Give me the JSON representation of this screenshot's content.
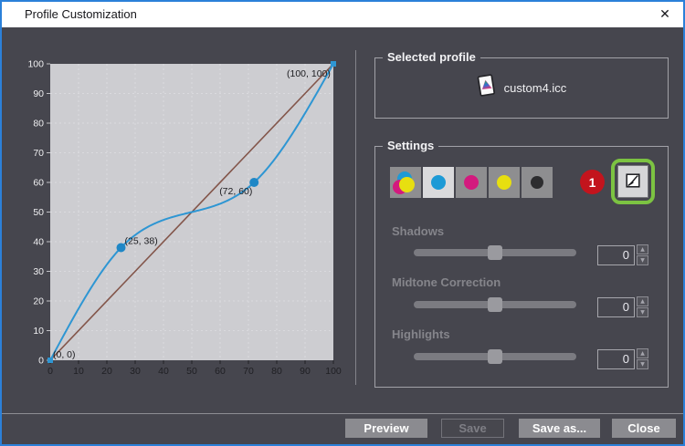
{
  "window": {
    "title": "Profile Customization",
    "close_glyph": "✕"
  },
  "chart_data": {
    "type": "line",
    "title": "",
    "xlabel": "",
    "ylabel": "",
    "xlim": [
      0,
      100
    ],
    "ylim": [
      0,
      100
    ],
    "x_ticks": [
      0,
      10,
      20,
      30,
      40,
      50,
      60,
      70,
      80,
      90,
      100
    ],
    "y_ticks": [
      0,
      10,
      20,
      30,
      40,
      50,
      60,
      70,
      80,
      90,
      100
    ],
    "grid": true,
    "legend": false,
    "series": [
      {
        "name": "reference-diagonal",
        "curve": "straight",
        "points": [
          [
            0,
            0
          ],
          [
            100,
            100
          ]
        ],
        "color": "#83564b",
        "width": 1.6
      },
      {
        "name": "tone-curve",
        "curve": "spline",
        "points": [
          [
            0,
            0
          ],
          [
            25,
            38
          ],
          [
            72,
            60
          ],
          [
            100,
            100
          ]
        ],
        "color": "#2e96d3",
        "width": 2
      }
    ],
    "point_labels": [
      {
        "text": "(0, 0)",
        "x": 0,
        "y": 0,
        "dx": 3,
        "dy": -3,
        "marker": "square"
      },
      {
        "text": "(25, 38)",
        "x": 25,
        "y": 38,
        "dx": 4,
        "dy": -4,
        "marker": "circle"
      },
      {
        "text": "(72, 60)",
        "x": 72,
        "y": 60,
        "dx": -38,
        "dy": 13,
        "marker": "circle"
      },
      {
        "text": "(100, 100)",
        "x": 100,
        "y": 100,
        "dx": -51,
        "dy": 14,
        "marker": "square"
      }
    ],
    "colors": {
      "plot_bg": "#cdcdd1",
      "grid": "#dadade",
      "y_tick": "#c2c2c7",
      "x_tick": "#222226",
      "y_label": "#f0f0f2",
      "x_label": "#1f1f23",
      "point_label": "#1c1c20",
      "marker_circle": "#1f87c6",
      "marker_square": "#2e96d3"
    }
  },
  "selected_profile": {
    "group_label": "Selected profile",
    "file_name": "custom4.icc"
  },
  "settings": {
    "group_label": "Settings",
    "channels": [
      {
        "name": "all-cmy",
        "selected": false
      },
      {
        "name": "cyan",
        "selected": true
      },
      {
        "name": "magenta",
        "selected": false
      },
      {
        "name": "yellow",
        "selected": false
      },
      {
        "name": "black",
        "selected": false
      }
    ],
    "channel_colors": {
      "cyan": "#1d9ad6",
      "magenta": "#d31a7e",
      "yellow": "#e7df10",
      "black": "#2d2d2f"
    },
    "annotation_badge": "1",
    "badge_color": "#c3141d",
    "highlight_color": "#7cc342",
    "spin_up_glyph": "▲",
    "spin_down_glyph": "▼",
    "sliders": [
      {
        "label": "Shadows",
        "value": "0"
      },
      {
        "label": "Midtone Correction",
        "value": "0"
      },
      {
        "label": "Highlights",
        "value": "0"
      }
    ]
  },
  "footer": {
    "buttons": [
      {
        "label": "Preview",
        "enabled": true
      },
      {
        "label": "Save",
        "enabled": false
      },
      {
        "label": "Save as...",
        "enabled": true
      },
      {
        "label": "Close",
        "enabled": true
      }
    ]
  }
}
